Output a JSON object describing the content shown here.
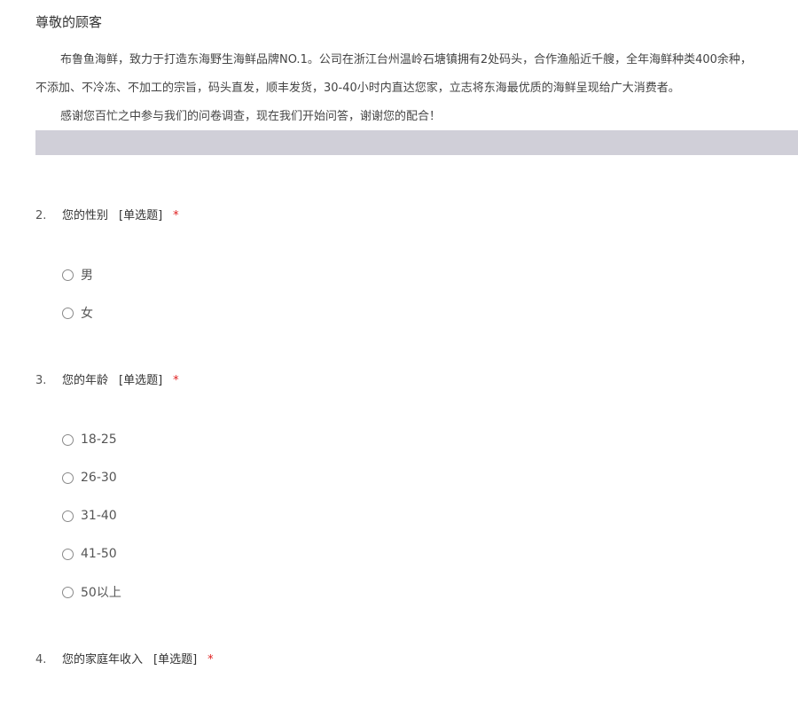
{
  "greeting": "尊敬的顾客",
  "intro": {
    "line1": "布鲁鱼海鲜，致力于打造东海野生海鲜品牌NO.1。公司在浙江台州温岭石塘镇拥有2处码头，合作渔船近千艘，全年海鲜种类400余种，",
    "line2": "不添加、不冷冻、不加工的宗旨，码头直发，顺丰发货，30-40小时内直达您家，立志将东海最优质的海鲜呈现给广大消费者。",
    "line3": "感谢您百忙之中参与我们的问卷调查，现在我们开始问答，谢谢您的配合！"
  },
  "questions": [
    {
      "number": "2.",
      "title": "您的性别",
      "type": "[单选题]",
      "required": "*",
      "options": [
        "男",
        "女"
      ]
    },
    {
      "number": "3.",
      "title": "您的年龄",
      "type": "[单选题]",
      "required": "*",
      "options": [
        "18-25",
        "26-30",
        "31-40",
        "41-50",
        "50以上"
      ]
    },
    {
      "number": "4.",
      "title": "您的家庭年收入",
      "type": "[单选题]",
      "required": "*",
      "options": []
    }
  ]
}
